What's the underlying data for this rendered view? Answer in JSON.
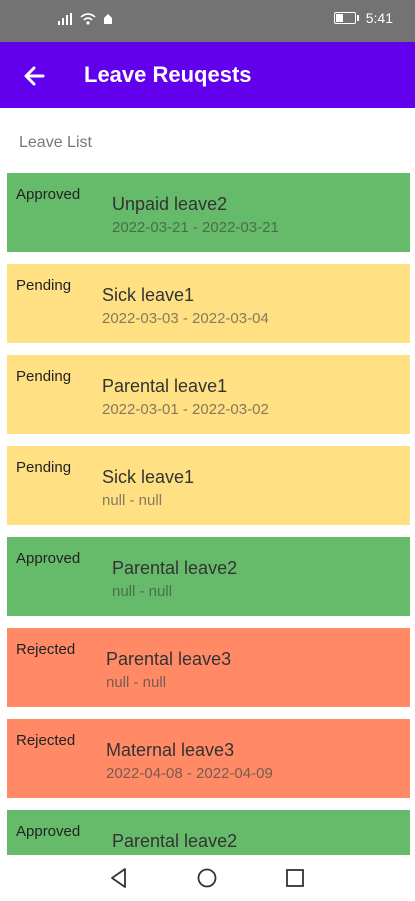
{
  "status_bar": {
    "signal": "⁴ᴳ",
    "time": "5:41"
  },
  "app_bar": {
    "title": "Leave Reuqests"
  },
  "list_label": "Leave List",
  "colors": {
    "approved": "#66bb6a",
    "pending": "#ffe082",
    "rejected": "#ff8a65",
    "appbar": "#6200ee"
  },
  "leaves": [
    {
      "status": "Approved",
      "name": "Unpaid leave2",
      "dates": "2022-03-21 - 2022-03-21"
    },
    {
      "status": "Pending",
      "name": "Sick leave1",
      "dates": "2022-03-03 - 2022-03-04"
    },
    {
      "status": "Pending",
      "name": "Parental leave1",
      "dates": "2022-03-01 - 2022-03-02"
    },
    {
      "status": "Pending",
      "name": "Sick leave1",
      "dates": "null - null"
    },
    {
      "status": "Approved",
      "name": "Parental leave2",
      "dates": "null - null"
    },
    {
      "status": "Rejected",
      "name": "Parental leave3",
      "dates": "null - null"
    },
    {
      "status": "Rejected",
      "name": "Maternal leave3",
      "dates": "2022-04-08 - 2022-04-09"
    },
    {
      "status": "Approved",
      "name": "Parental leave2",
      "dates": ""
    }
  ]
}
